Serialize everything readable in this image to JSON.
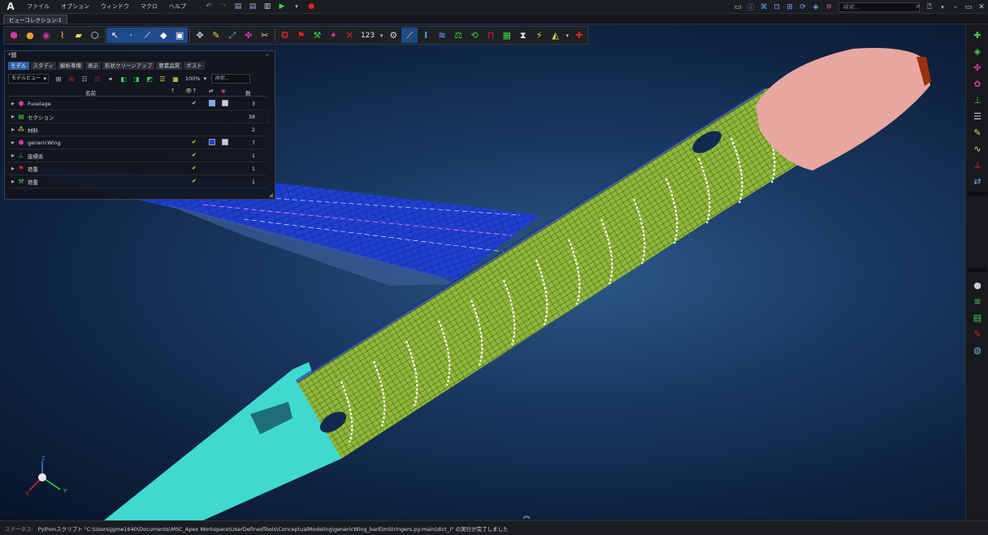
{
  "app": {
    "logo": "A",
    "menu": [
      "ファイル",
      "オプション",
      "ウィンドウ",
      "マクロ",
      "ヘルプ"
    ],
    "search_placeholder": "検索...",
    "view_tab": "ビューコレクション:1"
  },
  "toolbar": {
    "number_tool": "123"
  },
  "panel": {
    "title": "*圖",
    "tabs": [
      "モデル",
      "スタディ",
      "解析準備",
      "表示",
      "形状クリーンアップ",
      "要素品質",
      "ポスト"
    ],
    "active_tab": "モデル",
    "view_select": "モデルビュー",
    "zoom": "100%",
    "search_placeholder": "検索...",
    "columns": {
      "name": "名前",
      "count": "数"
    },
    "rows": [
      {
        "name": "Fuselage",
        "count": "3"
      },
      {
        "name": "セクション",
        "count": "38"
      },
      {
        "name": "材料",
        "count": "2"
      },
      {
        "name": "genericWing",
        "count": "7"
      },
      {
        "name": "座標系",
        "count": "1"
      },
      {
        "name": "荷重",
        "count": "1"
      },
      {
        "name": "荷重",
        "count": "1"
      }
    ]
  },
  "triad": {
    "x": "X",
    "y": "Y",
    "z": "Z"
  },
  "status": {
    "label": "ステータス:",
    "message": "Pythonスクリプト \"C:\\Users\\jgme1640\\Documents\\MSC_Apex Workspace\\UserDefinedTools\\ConceptualModeling\\genericWing_barElmStringers.py:main(dict_)\" の実行が完了しました"
  },
  "colors": {
    "wing": "#1f3fd6",
    "fuselage_mesh": "#8fb83a",
    "nose": "#e8a7a0",
    "tail": "#3fd9d0",
    "frames": "#ffffff"
  }
}
